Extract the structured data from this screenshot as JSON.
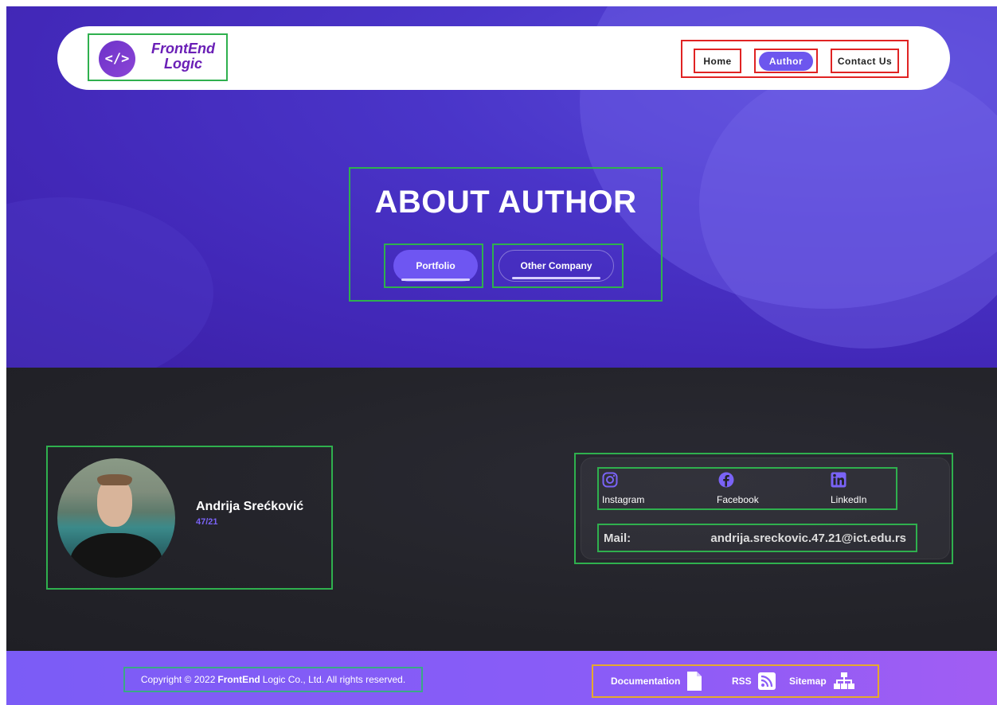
{
  "nav": {
    "logo_symbol": "</>",
    "logo_line1": "FrontEnd",
    "logo_line2": "Logic",
    "items": [
      {
        "label": "Home"
      },
      {
        "label": "Author"
      },
      {
        "label": "Contact Us"
      }
    ],
    "active_item": "Author"
  },
  "hero": {
    "title": "ABOUT AUTHOR",
    "buttons": [
      {
        "label": "Portfolio"
      },
      {
        "label": "Other Company"
      }
    ]
  },
  "author": {
    "name": "Andrija Srećković",
    "id": "47/21"
  },
  "contact": {
    "socials": [
      {
        "label": "Instagram",
        "icon": "instagram-icon"
      },
      {
        "label": "Facebook",
        "icon": "facebook-icon"
      },
      {
        "label": "LinkedIn",
        "icon": "linkedin-icon"
      }
    ],
    "mail_label": "Mail:",
    "mail_value": "andrija.sreckovic.47.21@ict.edu.rs"
  },
  "footer": {
    "copyright_prefix": "Copyright © 2022",
    "copyright_brand": "FrontEnd",
    "copyright_suffix": "Logic Co., Ltd. All rights reserved.",
    "links": [
      {
        "label": "Documentation",
        "icon": "document-icon"
      },
      {
        "label": "RSS",
        "icon": "rss-icon"
      },
      {
        "label": "Sitemap",
        "icon": "sitemap-icon"
      }
    ]
  },
  "colors": {
    "accent": "#6d56ee",
    "logo_text": "#6a1fb6",
    "hero_bg": "#4a35c9",
    "dark_bg": "#232329",
    "footer_bg": "#8a5cf7"
  }
}
